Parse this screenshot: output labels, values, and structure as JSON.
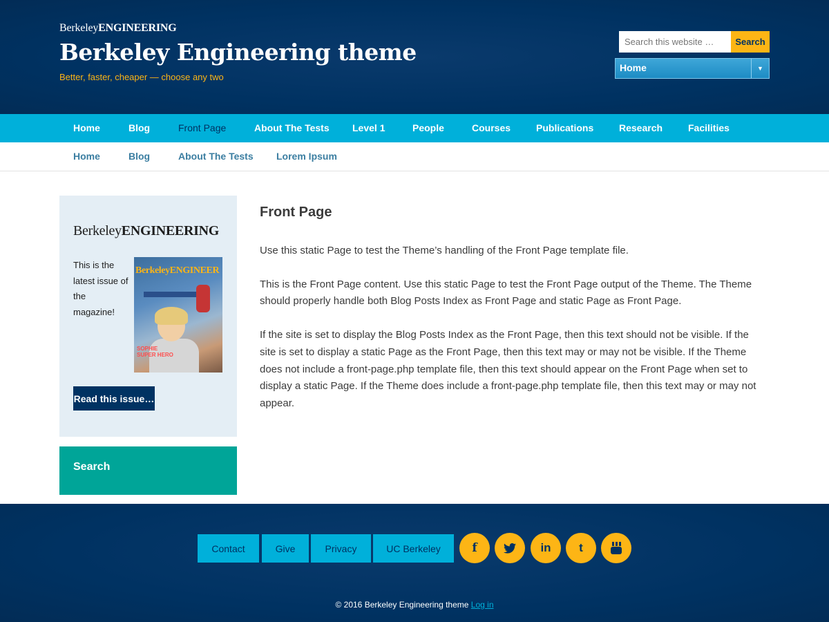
{
  "header": {
    "brand_regular": "Berkeley",
    "brand_bold": "ENGINEERING",
    "site_title": "Berkeley Engineering theme",
    "tagline": "Better, faster, cheaper — choose any two",
    "search": {
      "placeholder": "Search this website …",
      "button_label": "Search"
    },
    "nav_select": {
      "selected": "Home"
    }
  },
  "primary_nav": {
    "items": [
      {
        "label": "Home"
      },
      {
        "label": "Blog"
      },
      {
        "label": "Front Page"
      },
      {
        "label": "About The Tests"
      },
      {
        "label": "Level 1"
      },
      {
        "label": "People"
      },
      {
        "label": "Courses"
      },
      {
        "label": "Publications"
      },
      {
        "label": "Research"
      },
      {
        "label": "Facilities"
      }
    ],
    "current": "Front Page"
  },
  "secondary_nav": {
    "items": [
      {
        "label": "Home"
      },
      {
        "label": "Blog"
      },
      {
        "label": "About The Tests"
      },
      {
        "label": "Lorem Ipsum"
      }
    ]
  },
  "sidebar": {
    "magazine": {
      "logo_regular": "Berkeley",
      "logo_bold": "ENGINEERING",
      "description": "This is the latest issue of the magazine!",
      "cover_masthead_regular": "Berkeley",
      "cover_masthead_bold": "ENGINEER",
      "cover_caption_1": "SOPHIE",
      "cover_caption_2": "SUPER HERO",
      "button_label": "Read this issue…"
    },
    "search_widget": {
      "title": "Search"
    }
  },
  "content": {
    "title": "Front Page",
    "paragraphs": [
      "Use this static Page to test the Theme’s handling of the Front Page template file.",
      "This is the Front Page content. Use this static Page to test the Front Page output of the Theme. The Theme should properly handle both Blog Posts Index as Front Page and static Page as Front Page.",
      "If the site is set to display the Blog Posts Index as the Front Page, then this text should not be visible. If the site is set to display a static Page as the Front Page, then this text may or may not be visible. If the Theme does not include a front-page.php template file, then this text should appear on the Front Page when set to display a static Page. If the Theme does include a front-page.php template file, then this text may or may not appear."
    ]
  },
  "footer": {
    "links": [
      {
        "label": "Contact"
      },
      {
        "label": "Give"
      },
      {
        "label": "Privacy"
      },
      {
        "label": "UC Berkeley"
      }
    ],
    "social": [
      {
        "icon": "facebook-icon",
        "glyph": "f"
      },
      {
        "icon": "twitter-icon",
        "glyph": "🐦"
      },
      {
        "icon": "linkedin-icon",
        "glyph": "in"
      },
      {
        "icon": "tumblr-icon",
        "glyph": "t"
      },
      {
        "icon": "youtube-icon",
        "glyph": "▶"
      }
    ],
    "copyright": "© 2016 Berkeley Engineering theme",
    "login_label": "Log in"
  },
  "colors": {
    "berkeley_blue": "#003262",
    "california_gold": "#fdb515",
    "nav_cyan": "#00b0da",
    "teal": "#00a598",
    "sidebar_bg": "#e4eef5"
  }
}
